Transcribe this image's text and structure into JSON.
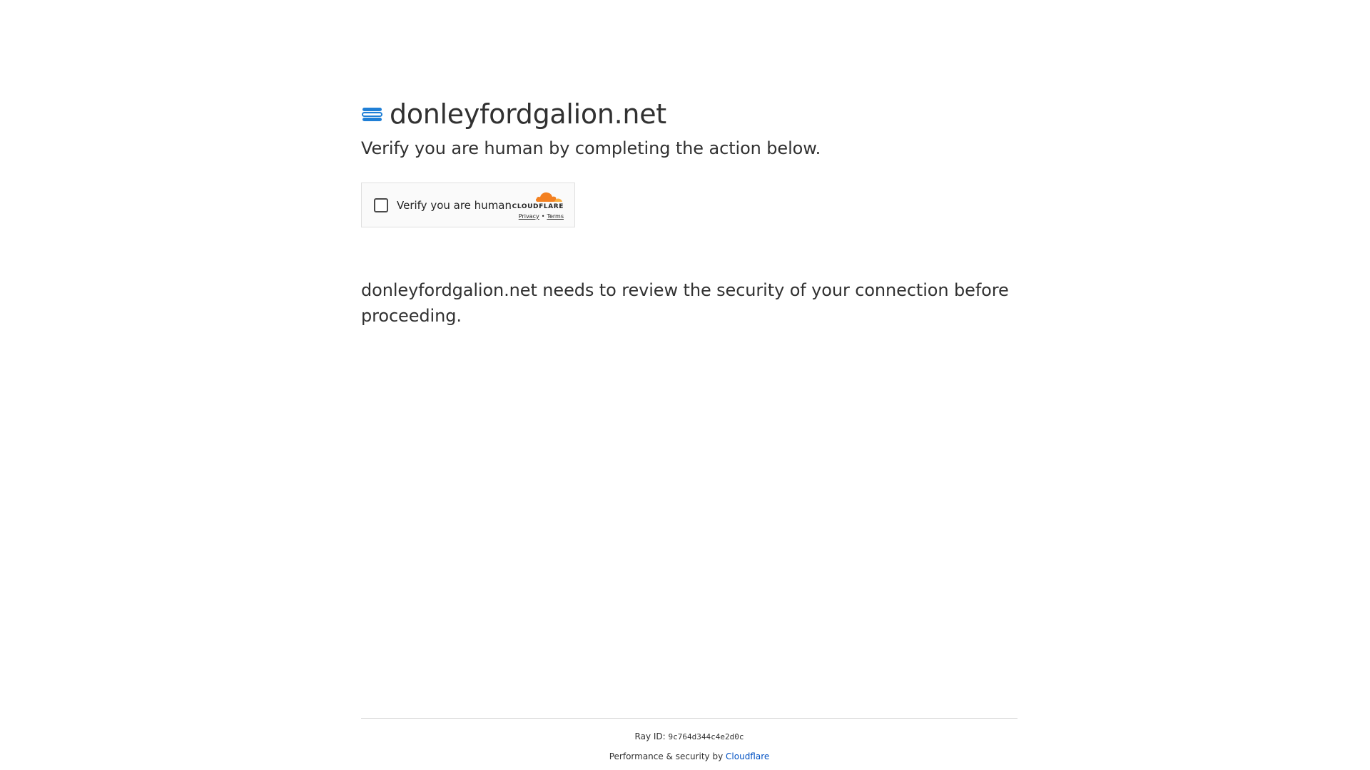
{
  "header": {
    "site_name": "donleyfordgalion.net",
    "icon": "site-favicon-icon"
  },
  "subtitle": "Verify you are human by completing the action below.",
  "challenge_widget": {
    "checkbox_label": "Verify you are human",
    "checkbox_checked": false,
    "brand_name": "CLOUDFLARE",
    "brand_icon": "cloudflare-cloud-icon",
    "privacy_link": "Privacy",
    "separator": "•",
    "terms_link": "Terms"
  },
  "description": "donleyfordgalion.net needs to review the security of your connection before proceeding.",
  "footer": {
    "ray_label": "Ray ID:",
    "ray_id": "9c764d344c4e2d0c",
    "performance_label": "Performance & security by",
    "cloudflare_link": "Cloudflare"
  },
  "colors": {
    "accent_blue": "#0051c3",
    "cloudflare_orange": "#f38020",
    "cloudflare_light_orange": "#faae40",
    "icon_blue": "#1f7fd6"
  }
}
